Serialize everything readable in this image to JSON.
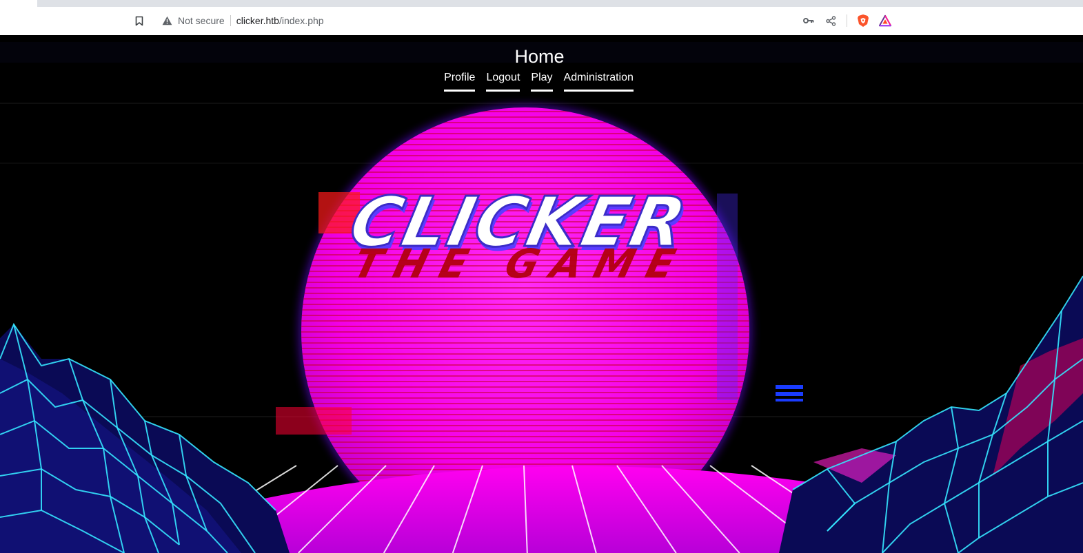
{
  "browser": {
    "security_label": "Not secure",
    "url_host": "clicker.htb",
    "url_path": "/index.php"
  },
  "page": {
    "title": "Home",
    "nav": [
      {
        "label": "Profile"
      },
      {
        "label": "Logout"
      },
      {
        "label": "Play"
      },
      {
        "label": "Administration"
      }
    ],
    "hero": {
      "logo_text": "CLICKER",
      "logo_subtitle": "THE GAME"
    }
  },
  "colors": {
    "sun": "#ff00ee",
    "sun_glow": "#7a1bff",
    "grid": "#35e6ff",
    "logo_text": "#ffffff",
    "logo_outline": "#5b3cff",
    "logo_subtitle": "#b3000f"
  },
  "icons": [
    "bookmark-icon",
    "warning-icon",
    "key-icon",
    "share-icon",
    "brave-shield-icon",
    "brave-rewards-icon"
  ]
}
